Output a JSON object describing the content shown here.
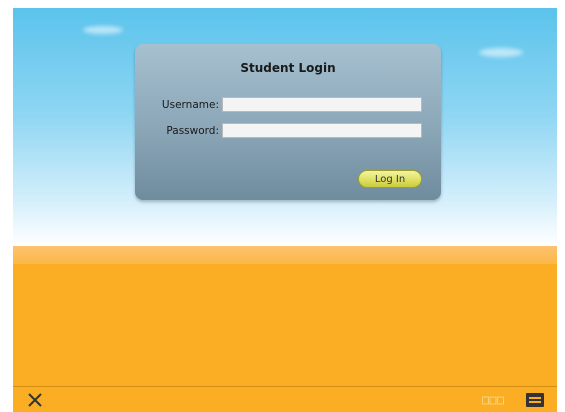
{
  "login": {
    "title": "Student Login",
    "username_label": "Username:",
    "username_value": "",
    "password_label": "Password:",
    "password_value": "",
    "login_button": "Log In"
  },
  "toolbar": {
    "close_icon": "close-icon",
    "grid_icon": "grid-view-icon",
    "panel_icon": "panel-view-icon"
  },
  "colors": {
    "sky_top": "#5bc3ec",
    "sand": "#fbad24",
    "panel": "#8aa6b7",
    "button": "#dfe064",
    "toolbar_icon": "#333333"
  }
}
